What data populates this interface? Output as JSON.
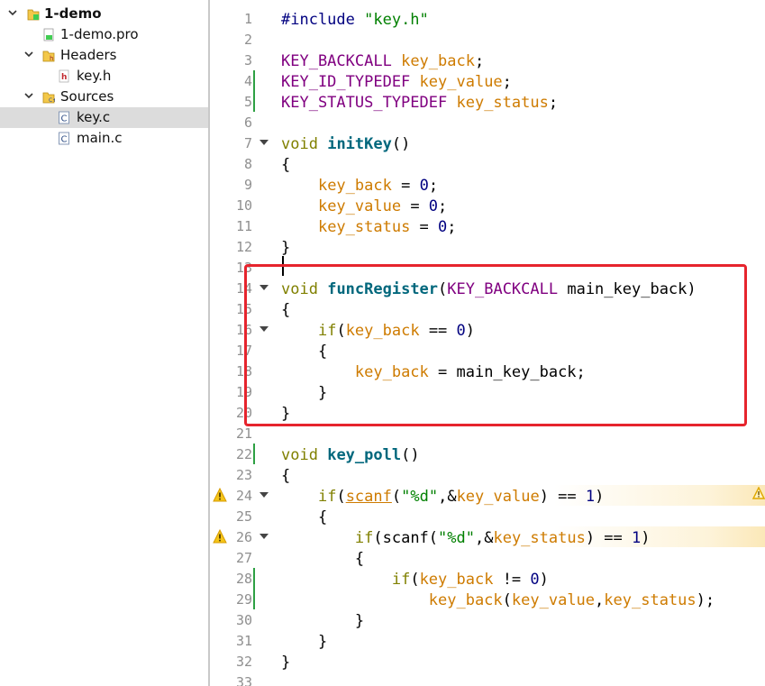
{
  "project_tree": {
    "items": [
      {
        "label": "1-demo",
        "icon": "qt-project-icon",
        "expanded": true,
        "bold": true,
        "selected": false
      },
      {
        "label": "1-demo.pro",
        "icon": "qt-pro-file-icon",
        "expanded": null,
        "bold": false,
        "selected": false
      },
      {
        "label": "Headers",
        "icon": "folder-headers-icon",
        "expanded": true,
        "bold": false,
        "selected": false
      },
      {
        "label": "key.h",
        "icon": "header-file-icon",
        "expanded": null,
        "bold": false,
        "selected": false
      },
      {
        "label": "Sources",
        "icon": "folder-sources-icon",
        "expanded": true,
        "bold": false,
        "selected": false
      },
      {
        "label": "key.c",
        "icon": "c-file-icon",
        "expanded": null,
        "bold": false,
        "selected": true
      },
      {
        "label": "main.c",
        "icon": "c-file-icon",
        "expanded": null,
        "bold": false,
        "selected": false
      }
    ]
  },
  "editor": {
    "lines": [
      {
        "num": "1",
        "tokens": [
          [
            "pp",
            "#include "
          ],
          [
            "str",
            "\"key.h\""
          ]
        ]
      },
      {
        "num": "2",
        "tokens": []
      },
      {
        "num": "3",
        "tokens": [
          [
            "type",
            "KEY_BACKCALL"
          ],
          [
            "plain",
            " "
          ],
          [
            "var",
            "key_back"
          ],
          [
            "plain",
            ";"
          ]
        ]
      },
      {
        "num": "4",
        "changed": true,
        "tokens": [
          [
            "type",
            "KEY_ID_TYPEDEF"
          ],
          [
            "plain",
            " "
          ],
          [
            "var",
            "key_value"
          ],
          [
            "plain",
            ";"
          ]
        ]
      },
      {
        "num": "5",
        "changed": true,
        "tokens": [
          [
            "type",
            "KEY_STATUS_TYPEDEF"
          ],
          [
            "plain",
            " "
          ],
          [
            "var",
            "key_status"
          ],
          [
            "plain",
            ";"
          ]
        ]
      },
      {
        "num": "6",
        "tokens": []
      },
      {
        "num": "7",
        "fold": true,
        "tokens": [
          [
            "kw",
            "void"
          ],
          [
            "plain",
            " "
          ],
          [
            "fn",
            "initKey"
          ],
          [
            "plain",
            "()"
          ]
        ]
      },
      {
        "num": "8",
        "tokens": [
          [
            "plain",
            "{"
          ]
        ]
      },
      {
        "num": "9",
        "tokens": [
          [
            "plain",
            "    "
          ],
          [
            "var",
            "key_back"
          ],
          [
            "plain",
            " = "
          ],
          [
            "num",
            "0"
          ],
          [
            "plain",
            ";"
          ]
        ]
      },
      {
        "num": "10",
        "tokens": [
          [
            "plain",
            "    "
          ],
          [
            "var",
            "key_value"
          ],
          [
            "plain",
            " = "
          ],
          [
            "num",
            "0"
          ],
          [
            "plain",
            ";"
          ]
        ]
      },
      {
        "num": "11",
        "tokens": [
          [
            "plain",
            "    "
          ],
          [
            "var",
            "key_status"
          ],
          [
            "plain",
            " = "
          ],
          [
            "num",
            "0"
          ],
          [
            "plain",
            ";"
          ]
        ]
      },
      {
        "num": "12",
        "tokens": [
          [
            "plain",
            "}"
          ]
        ]
      },
      {
        "num": "13",
        "tokens": []
      },
      {
        "num": "14",
        "fold": true,
        "tokens": [
          [
            "kw",
            "void"
          ],
          [
            "plain",
            " "
          ],
          [
            "fn",
            "funcRegister"
          ],
          [
            "plain",
            "("
          ],
          [
            "type",
            "KEY_BACKCALL"
          ],
          [
            "plain",
            " main_key_back)"
          ]
        ]
      },
      {
        "num": "15",
        "tokens": [
          [
            "plain",
            "{"
          ]
        ]
      },
      {
        "num": "16",
        "fold": true,
        "tokens": [
          [
            "plain",
            "    "
          ],
          [
            "kw",
            "if"
          ],
          [
            "plain",
            "("
          ],
          [
            "var",
            "key_back"
          ],
          [
            "plain",
            " == "
          ],
          [
            "num",
            "0"
          ],
          [
            "plain",
            ")"
          ]
        ]
      },
      {
        "num": "17",
        "tokens": [
          [
            "plain",
            "    {"
          ]
        ]
      },
      {
        "num": "18",
        "tokens": [
          [
            "plain",
            "        "
          ],
          [
            "var",
            "key_back"
          ],
          [
            "plain",
            " = main_key_back;"
          ]
        ]
      },
      {
        "num": "19",
        "tokens": [
          [
            "plain",
            "    }"
          ]
        ]
      },
      {
        "num": "20",
        "tokens": [
          [
            "plain",
            "}"
          ]
        ]
      },
      {
        "num": "21",
        "tokens": []
      },
      {
        "num": "22",
        "changed": true,
        "tokens": [
          [
            "kw",
            "void"
          ],
          [
            "plain",
            " "
          ],
          [
            "fn",
            "key_poll"
          ],
          [
            "plain",
            "()"
          ]
        ]
      },
      {
        "num": "23",
        "tokens": [
          [
            "plain",
            "{"
          ]
        ]
      },
      {
        "num": "24",
        "fold": true,
        "warning": true,
        "tokens": [
          [
            "plain",
            "    "
          ],
          [
            "kw",
            "if"
          ],
          [
            "plain",
            "("
          ],
          [
            "ul",
            "scanf"
          ],
          [
            "plain",
            "("
          ],
          [
            "str",
            "\"%d\""
          ],
          [
            "plain",
            ",&"
          ],
          [
            "var",
            "key_value"
          ],
          [
            "plain",
            ") == "
          ],
          [
            "num",
            "1"
          ],
          [
            "plain",
            ")"
          ]
        ]
      },
      {
        "num": "25",
        "tokens": [
          [
            "plain",
            "    {"
          ]
        ]
      },
      {
        "num": "26",
        "fold": true,
        "warning": true,
        "tokens": [
          [
            "plain",
            "        "
          ],
          [
            "kw",
            "if"
          ],
          [
            "plain",
            "(scanf("
          ],
          [
            "str",
            "\"%d\""
          ],
          [
            "plain",
            ",&"
          ],
          [
            "var",
            "key_status"
          ],
          [
            "plain",
            ") == "
          ],
          [
            "num",
            "1"
          ],
          [
            "plain",
            ")"
          ]
        ]
      },
      {
        "num": "27",
        "tokens": [
          [
            "plain",
            "        {"
          ]
        ]
      },
      {
        "num": "28",
        "changed": true,
        "tokens": [
          [
            "plain",
            "            "
          ],
          [
            "kw",
            "if"
          ],
          [
            "plain",
            "("
          ],
          [
            "var",
            "key_back"
          ],
          [
            "plain",
            " != "
          ],
          [
            "num",
            "0"
          ],
          [
            "plain",
            ")"
          ]
        ]
      },
      {
        "num": "29",
        "changed": true,
        "tokens": [
          [
            "plain",
            "                "
          ],
          [
            "var",
            "key_back"
          ],
          [
            "plain",
            "("
          ],
          [
            "var",
            "key_value"
          ],
          [
            "plain",
            ","
          ],
          [
            "var",
            "key_status"
          ],
          [
            "plain",
            ");"
          ]
        ]
      },
      {
        "num": "30",
        "tokens": [
          [
            "plain",
            "        }"
          ]
        ]
      },
      {
        "num": "31",
        "tokens": [
          [
            "plain",
            "    }"
          ]
        ]
      },
      {
        "num": "32",
        "tokens": [
          [
            "plain",
            "}"
          ]
        ]
      },
      {
        "num": "33",
        "tokens": []
      }
    ]
  },
  "colors": {
    "highlight_box": "#e6242d",
    "selection": "#dcdcdc",
    "changed_marker": "#2ea043",
    "warning": "#f0b400"
  },
  "icons": [
    "expand-arrow-icon",
    "warning-icon",
    "fold-marker-icon"
  ]
}
